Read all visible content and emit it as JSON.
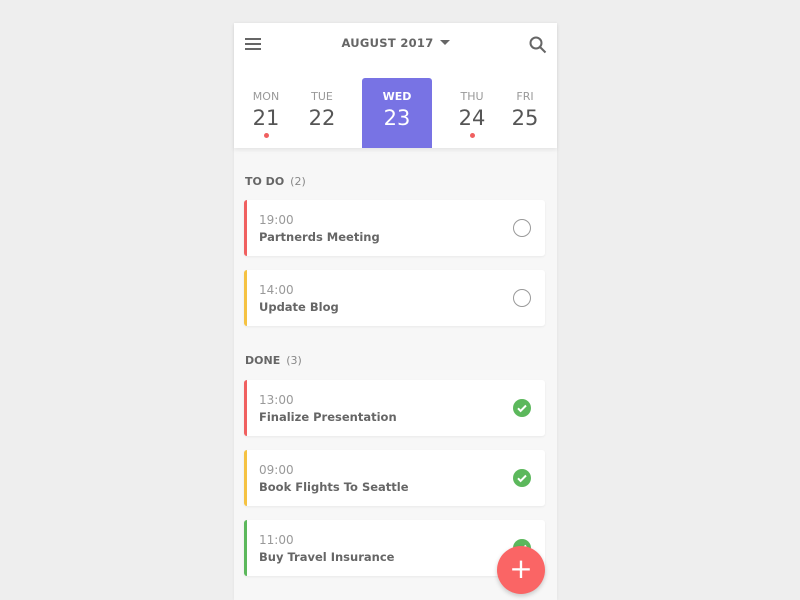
{
  "header": {
    "title": "AUGUST 2017",
    "menu_icon": "hamburger-icon",
    "search_icon": "search-icon"
  },
  "days": [
    {
      "name": "MON",
      "date": "21",
      "has_event": true,
      "selected": false
    },
    {
      "name": "TUE",
      "date": "22",
      "has_event": false,
      "selected": false
    },
    {
      "name": "WED",
      "date": "23",
      "has_event": false,
      "selected": true
    },
    {
      "name": "THU",
      "date": "24",
      "has_event": true,
      "selected": false
    },
    {
      "name": "FRI",
      "date": "25",
      "has_event": false,
      "selected": false
    }
  ],
  "todo": {
    "label": "TO DO",
    "count": "(2)",
    "items": [
      {
        "time": "19:00",
        "title": "Partnerds Meeting",
        "color": "#f06060",
        "done": false
      },
      {
        "time": "14:00",
        "title": "Update Blog",
        "color": "#f5c242",
        "done": false
      }
    ]
  },
  "done": {
    "label": "DONE",
    "count": "(3)",
    "items": [
      {
        "time": "13:00",
        "title": "Finalize Presentation",
        "color": "#f06060",
        "done": true
      },
      {
        "time": "09:00",
        "title": "Book Flights To Seattle",
        "color": "#f5c242",
        "done": true
      },
      {
        "time": "11:00",
        "title": "Buy Travel Insurance",
        "color": "#5cb85c",
        "done": true
      }
    ]
  },
  "fab": {
    "label": "+"
  },
  "colors": {
    "accent": "#7873e4",
    "fab": "#fa6565",
    "check": "#5cb85c"
  }
}
